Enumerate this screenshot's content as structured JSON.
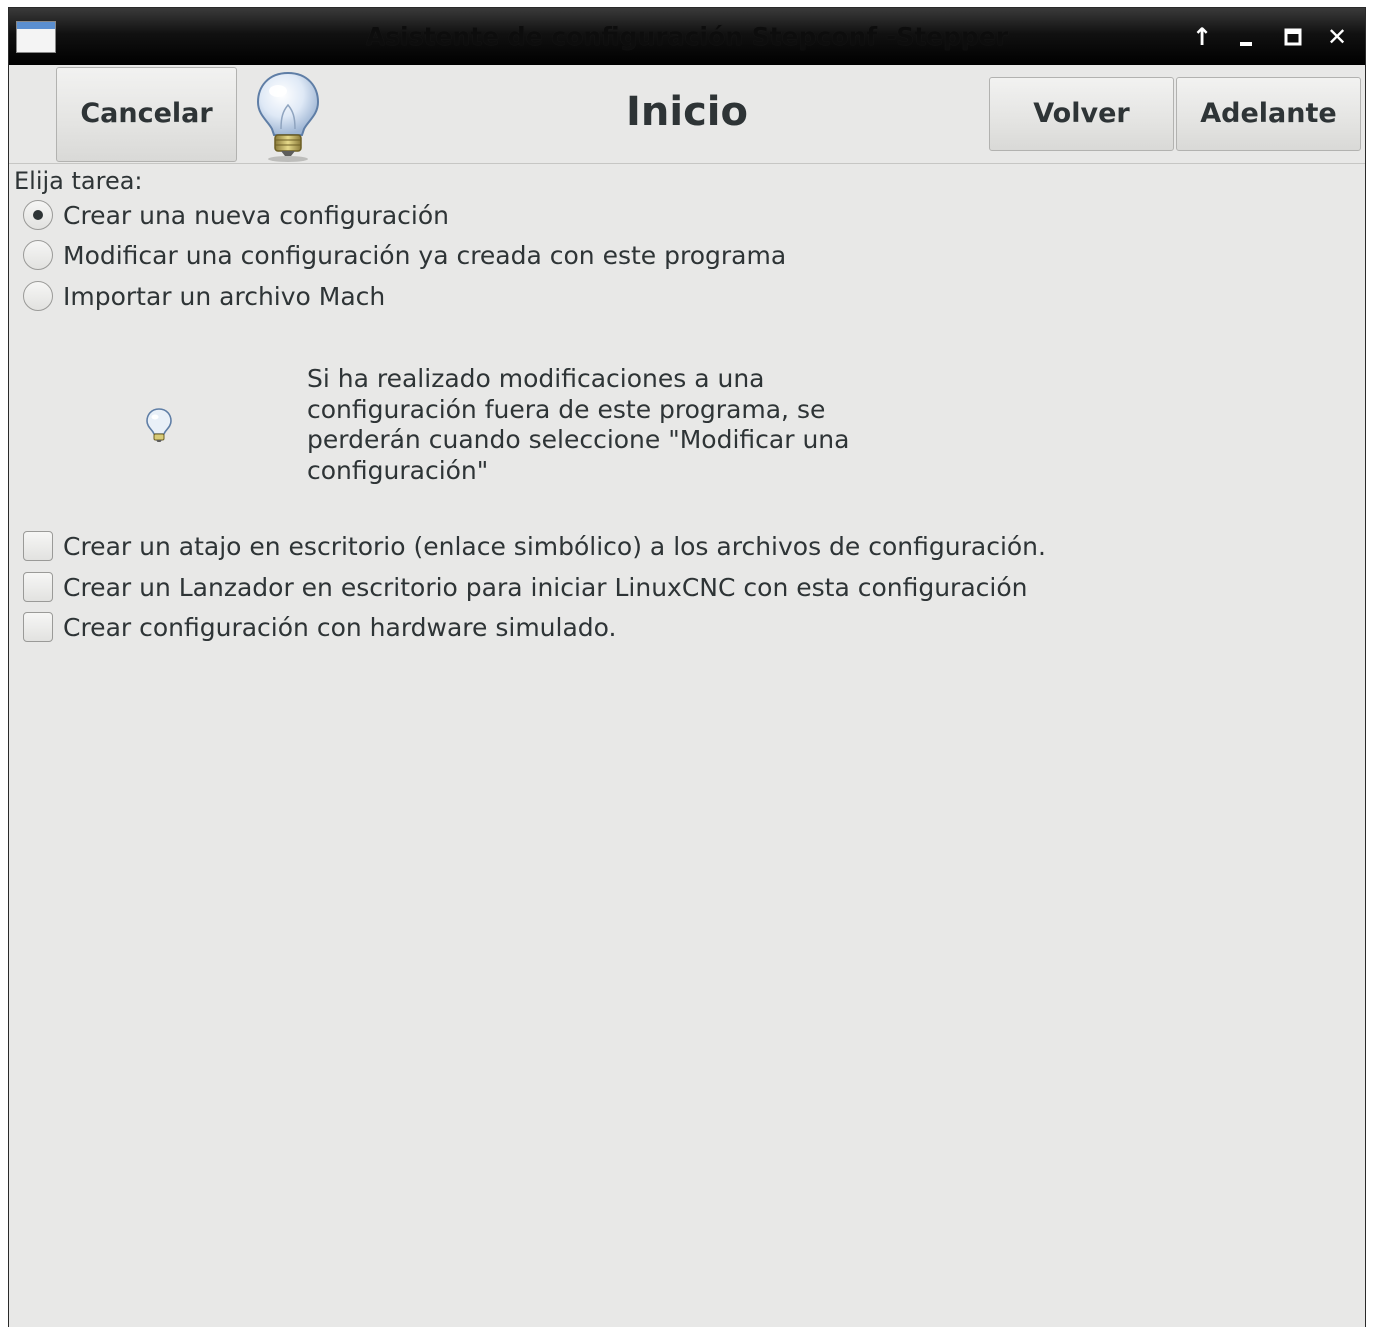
{
  "window": {
    "title": "Asistente de configuración Stepconf -Stepper",
    "controls": {
      "up": "↑",
      "minimize": "‗",
      "maximize": "☐",
      "close": "✕"
    }
  },
  "toolbar": {
    "cancel_label": "Cancelar",
    "page_title": "Inicio",
    "back_label": "Volver",
    "next_label": "Adelante"
  },
  "task": {
    "label": "Elija tarea:",
    "options": [
      {
        "label": "Crear una nueva configuración",
        "checked": true
      },
      {
        "label": "Modificar una configuración ya creada con este programa",
        "checked": false
      },
      {
        "label": "Importar un archivo Mach",
        "checked": false
      }
    ]
  },
  "hint": {
    "icon": "lightbulb-icon",
    "text": "Si ha realizado modificaciones a una\nconfiguración fuera de este programa, se\nperderán cuando seleccione \"Modificar una\nconfiguración\""
  },
  "checkboxes": [
    {
      "label": "Crear un atajo en escritorio (enlace simbólico) a los archivos de configuración.",
      "checked": false
    },
    {
      "label": "Crear un Lanzador en escritorio para iniciar LinuxCNC con esta configuración",
      "checked": false
    },
    {
      "label": "Crear configuración con hardware simulado.",
      "checked": false
    }
  ],
  "colors": {
    "background": "#e8e8e7",
    "text": "#2e3436",
    "titlebar": "#000000"
  }
}
